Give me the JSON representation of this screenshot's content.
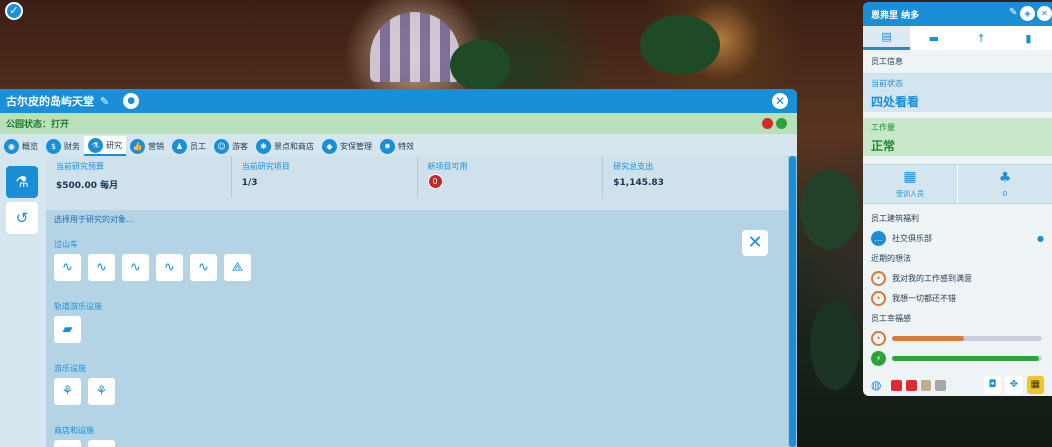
{
  "park": {
    "title": "古尔皮的岛屿天堂",
    "status": "公园状态：打开",
    "tabs": [
      {
        "label": "概览",
        "icon": "eye-icon"
      },
      {
        "label": "财务",
        "icon": "dollar-icon"
      },
      {
        "label": "研究",
        "icon": "flask-icon"
      },
      {
        "label": "营销",
        "icon": "thumbs-up-icon"
      },
      {
        "label": "员工",
        "icon": "staff-icon"
      },
      {
        "label": "游客",
        "icon": "guests-icon"
      },
      {
        "label": "景点和商店",
        "icon": "ferris-wheel-icon"
      },
      {
        "label": "安保管理",
        "icon": "shield-icon"
      },
      {
        "label": "特效",
        "icon": "fireworks-icon"
      }
    ],
    "stats": [
      {
        "label": "当前研究预算",
        "value": "$500.00 每月"
      },
      {
        "label": "当前研究项目",
        "value": "1/3"
      },
      {
        "label": "新项目可用",
        "value": "0"
      },
      {
        "label": "研究总支出",
        "value": "$1,145.83"
      }
    ],
    "prompt": "选择用于研究的对象...",
    "categories": [
      {
        "label": "过山车",
        "count": 6
      },
      {
        "label": "轨道游乐设施",
        "count": 1
      },
      {
        "label": "游乐设施",
        "count": 2
      },
      {
        "label": "商店和设施",
        "count": 2
      }
    ],
    "status_colors": {
      "red": "#d32a2a",
      "green": "#2ba33a"
    }
  },
  "staff": {
    "name": "恩弗里 纳多",
    "info_label": "员工信息",
    "current_status_label": "当前状态",
    "current_status_value": "四处看看",
    "workload_label": "工作量",
    "workload_value": "正常",
    "trained_label": "受训人员",
    "trained_count": "0",
    "welfare_label": "员工建筑福利",
    "welfare_item": "社交俱乐部",
    "thoughts_label": "近期的想法",
    "thoughts": [
      "我对我的工作感到满意",
      "我想一切都还不错"
    ],
    "happiness_label": "员工幸福感",
    "happiness_level": 0.48,
    "energy_level": 0.98,
    "swatch_colors": [
      "#e0282e",
      "#e0282e",
      "#c2ae8e",
      "#a6a6a6"
    ],
    "accent": "#1a8fd8"
  }
}
